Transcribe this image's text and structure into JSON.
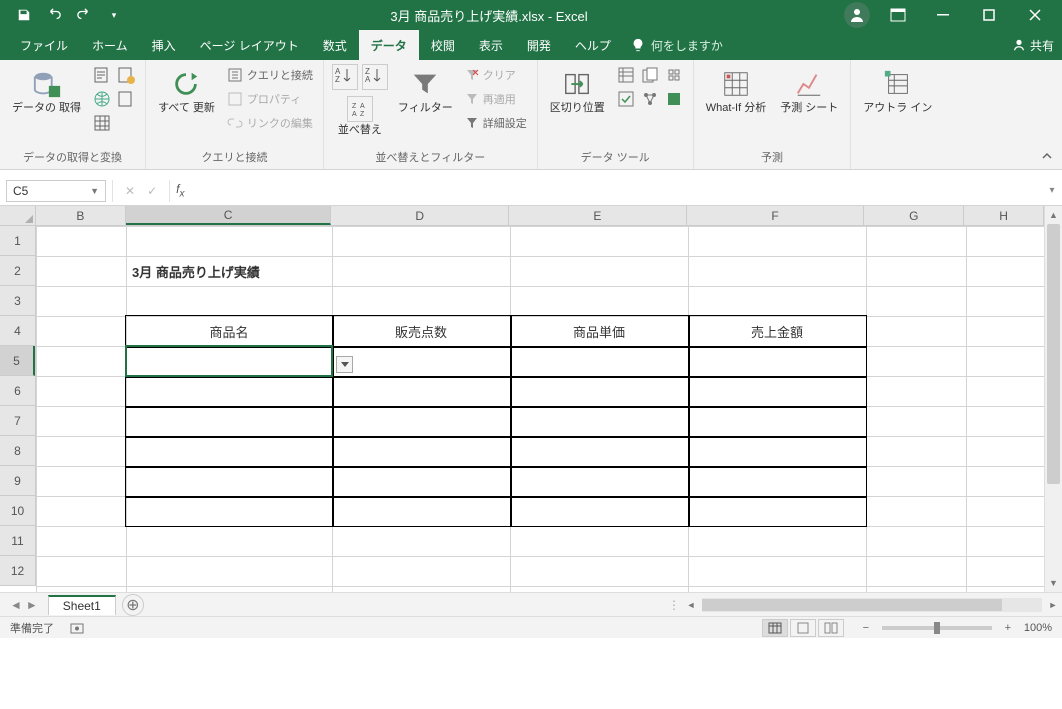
{
  "title": "3月 商品売り上げ実績.xlsx  -  Excel",
  "menu": {
    "file": "ファイル",
    "home": "ホーム",
    "insert": "挿入",
    "pagelayout": "ページ レイアウト",
    "formulas": "数式",
    "data": "データ",
    "review": "校閲",
    "view": "表示",
    "developer": "開発",
    "help": "ヘルプ",
    "tellme": "何をしますか",
    "share": "共有"
  },
  "ribbon": {
    "getdata": {
      "btn": "データの\n取得",
      "group": "データの取得と変換"
    },
    "refresh": {
      "btn": "すべて\n更新",
      "q1": "クエリと接続",
      "q2": "プロパティ",
      "q3": "リンクの編集",
      "group": "クエリと接続"
    },
    "sort": {
      "btn": "並べ替え",
      "filter": "フィルター",
      "clear": "クリア",
      "reapply": "再適用",
      "adv": "詳細設定",
      "group": "並べ替えとフィルター"
    },
    "texttocol": {
      "btn": "区切り位置",
      "group": "データ ツール"
    },
    "forecast": {
      "whatif": "What-If 分析",
      "sheet": "予測\nシート",
      "group": "予測"
    },
    "outline": {
      "btn": "アウトラ\nイン",
      "group": ""
    }
  },
  "namebox": "C5",
  "columns": [
    "B",
    "C",
    "D",
    "E",
    "F",
    "G",
    "H"
  ],
  "activeCol": "C",
  "rows": [
    "1",
    "2",
    "3",
    "4",
    "5",
    "6",
    "7",
    "8",
    "9",
    "10",
    "11",
    "12"
  ],
  "activeRow": "5",
  "cells": {
    "title": "3月 商品売り上げ実績",
    "h1": "商品名",
    "h2": "販売点数",
    "h3": "商品単価",
    "h4": "売上金額"
  },
  "sheetTab": "Sheet1",
  "status": "準備完了",
  "zoom": "100%"
}
